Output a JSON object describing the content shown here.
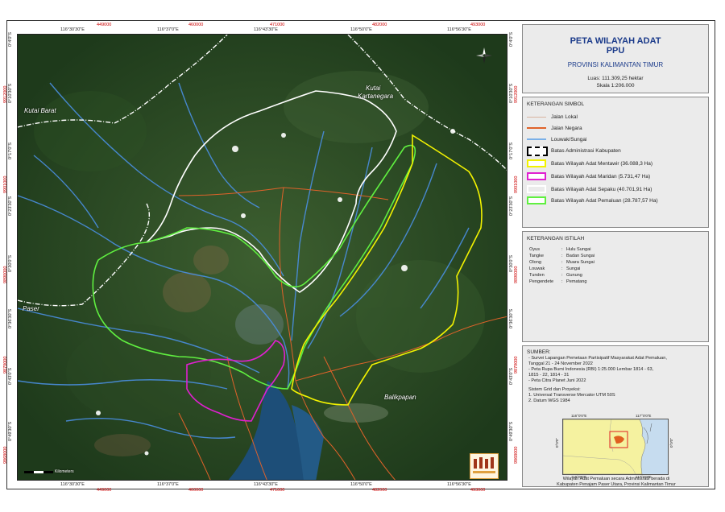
{
  "map": {
    "top_coords_black": [
      "116°30'30\"E",
      "116°37'0\"E",
      "116°43'30\"E",
      "116°50'0\"E",
      "116°56'30\"E"
    ],
    "top_coords_red": [
      "449000",
      "460000",
      "471000",
      "482000",
      "493000"
    ],
    "bottom_coords_black": [
      "116°30'30\"E",
      "116°37'0\"E",
      "116°43'30\"E",
      "116°50'0\"E",
      "116°56'30\"E"
    ],
    "bottom_coords_red": [
      "449000",
      "460000",
      "471000",
      "482000",
      "493000"
    ],
    "left_coords_black": [
      "0°4'0\"S",
      "0°10'30\"S",
      "0°17'0\"S",
      "0°23'30\"S",
      "0°30'0\"S",
      "0°36'30\"S",
      "0°43'0\"S",
      "0°49'30\"S"
    ],
    "left_coords_red": [
      "9912000",
      "9901000",
      "9890000",
      "9879000",
      "9868000"
    ],
    "right_coords_black": [
      "0°4'0\"S",
      "0°10'30\"S",
      "0°17'0\"S",
      "0°23'30\"S",
      "0°30'0\"S",
      "0°36'30\"S",
      "0°43'0\"S",
      "0°49'30\"S"
    ],
    "right_coords_red": [
      "9912000",
      "9901000",
      "9890000",
      "9879000",
      "9868000"
    ],
    "place_labels": {
      "kutai_barat": "Kutai Barat",
      "kutai_kartanegara_1": "Kutai",
      "kutai_kartanegara_2": "Kartanegara",
      "paser": "Paser",
      "balikpapan": "Balikpapan"
    },
    "scalebar_label": "Kilometers"
  },
  "title_block": {
    "title": "PETA WILAYAH ADAT",
    "subtitle": "PPU",
    "province": "PROVINSI KALIMANTAN TIMUR",
    "area": "Luas: 111.309,25 hektar",
    "scale": "Skala   1:206.000"
  },
  "legend": {
    "header": "KETERANGAN SIMBOL",
    "items": [
      {
        "label": "Jalan Lokal",
        "color": "#d9b3a0",
        "style": "thin"
      },
      {
        "label": "Jalan Negara",
        "color": "#e0622a",
        "style": "line"
      },
      {
        "label": "Louwak/Sungai",
        "color": "#7ab0e8",
        "style": "line"
      },
      {
        "label": "Batas Administrasi Kabupaten",
        "color": "#000000",
        "style": "admin"
      },
      {
        "label": "Batas Wilayah Adat Mentawir (36.088,3 Ha)",
        "color": "#f2f200",
        "style": "box"
      },
      {
        "label": "Batas Wilayah Adat Maridan (5.731,47 Ha)",
        "color": "#e020d0",
        "style": "box"
      },
      {
        "label": "Batas Wilayah Adat Sepaku (40.701,91 Ha)",
        "color": "#ffffff",
        "style": "box"
      },
      {
        "label": "Batas Wilayah Adat Pemaluan (28.787,57 Ha)",
        "color": "#60f040",
        "style": "box"
      }
    ]
  },
  "terms": {
    "header": "KETERANGAN ISTILAH",
    "items": [
      {
        "term": "Oyus",
        "meaning": "Hulu Sungai"
      },
      {
        "term": "Tangke",
        "meaning": "Badan Sungai"
      },
      {
        "term": "Olong",
        "meaning": "Muara Sungai"
      },
      {
        "term": "Louwak",
        "meaning": "Sungai"
      },
      {
        "term": "Tunden",
        "meaning": "Gunung"
      },
      {
        "term": "Pengendete",
        "meaning": "Pematang"
      }
    ]
  },
  "sources": {
    "header": "SUMBER:",
    "lines": [
      "- Survei Lapangan Pemetaan Partisipatif Masyarakat Adat Pemaluan,",
      "  Tanggal 21 - 24 November 2022",
      "- Peta Rupa Bumi Indonesia (RBI) 1:25.000 Lembar  1814 - 63,",
      "  1815 - 22, 1814 - 31",
      "- Peta Citra Planet Juni 2022"
    ],
    "grid_header": "Sistem Grid dan Proyeksi:",
    "grid_lines": [
      "1. Universal Transverse Mercator UTM 50S",
      "2. Datum WGS 1984"
    ]
  },
  "inset": {
    "top_coords": [
      "116°0'0\"E",
      "117°0'0\"E"
    ],
    "bottom_coords": [
      "116°0'0\"E",
      "117°0'0\"E"
    ],
    "left_coord": "0°0'0\"",
    "right_coord": "0°0'0\"",
    "caption_1": "Wilayah Adat Pemaluan secara Administratif berada di",
    "caption_2": "Kabupaten Penajam Paser Utara, Provinsi Kalimantan Timur"
  },
  "colors": {
    "title_blue": "#1a3a8a",
    "coord_red": "#cc0000",
    "mentawir": "#f2f200",
    "maridan": "#e020d0",
    "sepaku": "#ffffff",
    "pemaluan": "#60f040",
    "jalan_negara": "#e0622a",
    "sungai": "#4a8ee0"
  }
}
